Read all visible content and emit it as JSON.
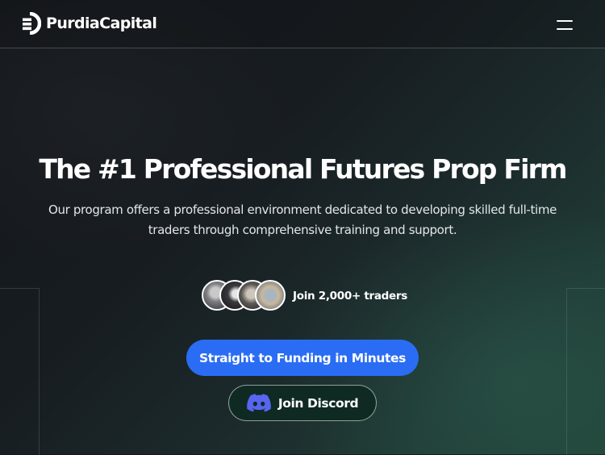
{
  "brand": {
    "name": "PurdiaCapital",
    "logo_icon": "purdia-logo-icon"
  },
  "nav": {
    "menu_icon": "hamburger-menu-icon"
  },
  "hero": {
    "title": "The #1 Professional Futures Prop Firm",
    "subtitle": "Our program offers a professional environment dedicated to developing skilled full-time traders through comprehensive training and support."
  },
  "social_proof": {
    "label": "Join 2,000+ traders",
    "avatars": [
      "trader-avatar-1",
      "trader-avatar-2",
      "trader-avatar-3",
      "trader-avatar-4"
    ]
  },
  "cta": {
    "primary_label": "Straight to Funding in Minutes",
    "discord_label": "Join Discord",
    "discord_icon": "discord-icon"
  },
  "colors": {
    "accent_blue": "#2a6df4",
    "discord_bg": "#0f2a23",
    "background_dark": "#15181c",
    "background_green": "#214339",
    "discord_brand": "#5865f2"
  }
}
